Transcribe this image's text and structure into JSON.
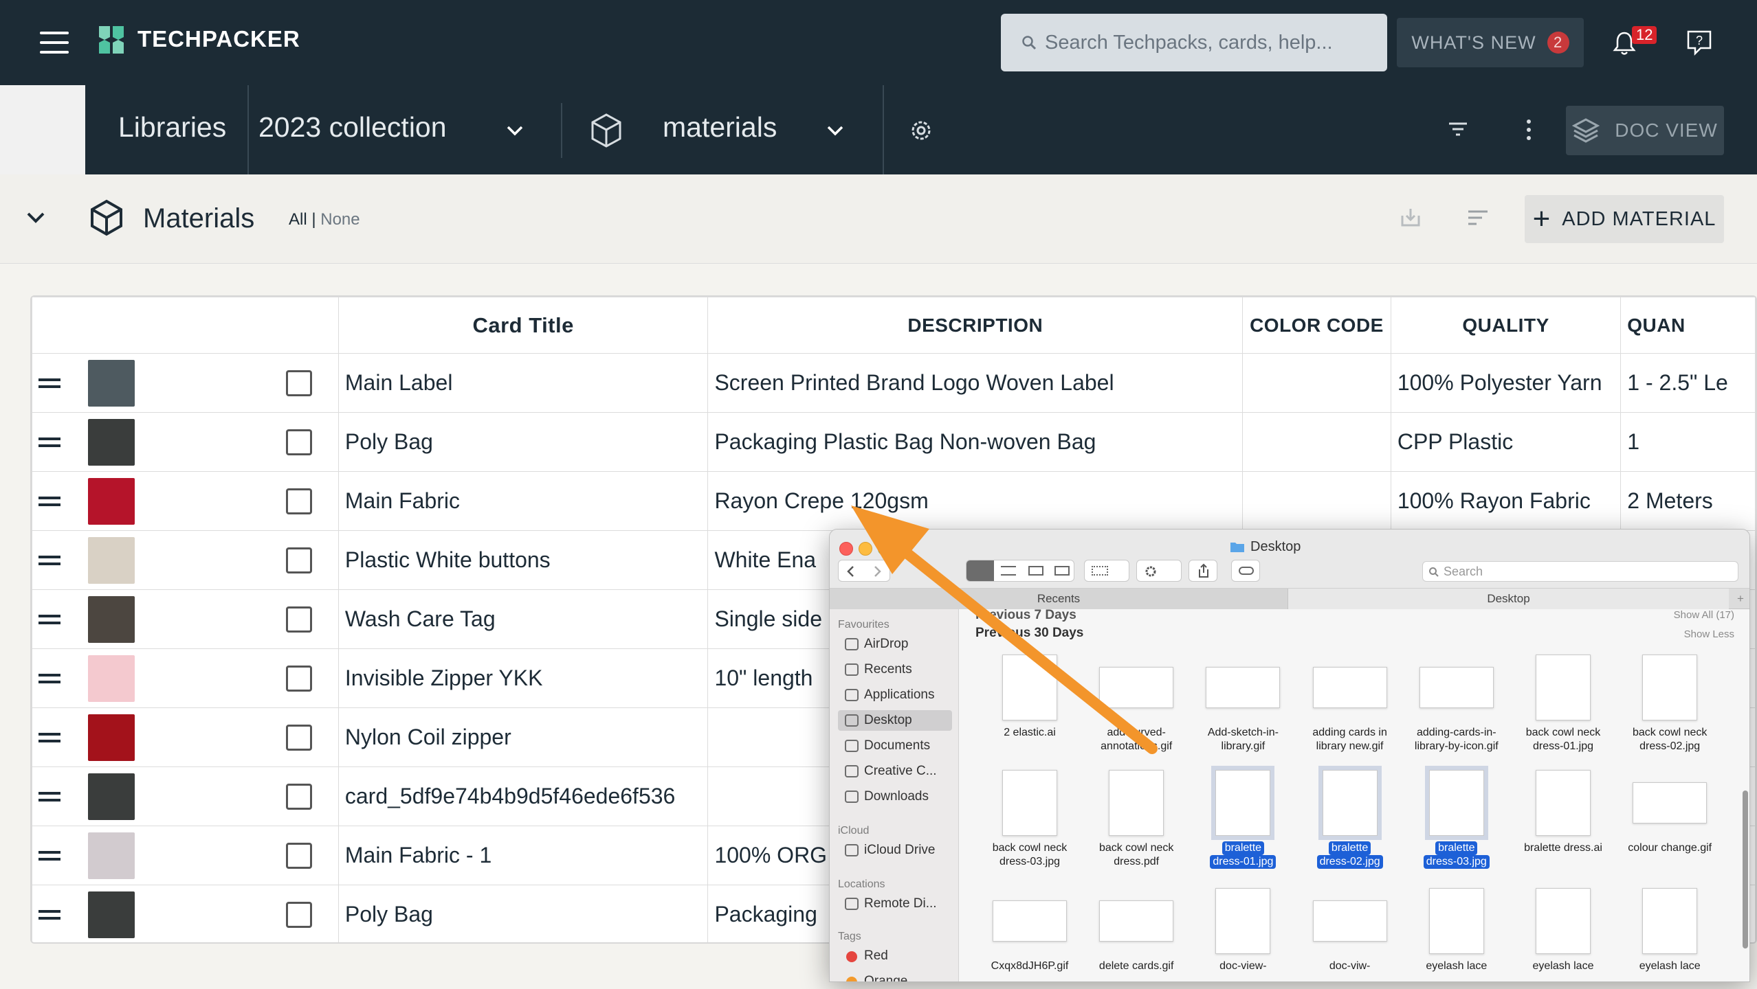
{
  "topbar": {
    "brand": "TECHPACKER",
    "search_placeholder": "Search Techpacks, cards, help...",
    "whats_new": "WHAT'S NEW",
    "whats_new_count": "2",
    "notifications_count": "12"
  },
  "secbar": {
    "libraries": "Libraries",
    "collection": "2023 collection",
    "materials": "materials",
    "doc_view": "DOC VIEW"
  },
  "materials_header": {
    "title": "Materials",
    "all": "All",
    "separator": "|",
    "none": "None",
    "add_button": "ADD MATERIAL"
  },
  "table": {
    "headers": [
      "Card Title",
      "DESCRIPTION",
      "COLOR CODE",
      "QUALITY",
      "QUAN"
    ],
    "rows": [
      {
        "title": "Main Label",
        "description": "Screen Printed Brand Logo Woven Label",
        "color_code": "",
        "quality": "100% Polyester Yarn",
        "quantity": "1 - 2.5\" Le",
        "thumb": "#4e5a60"
      },
      {
        "title": "Poly Bag",
        "description": "Packaging Plastic Bag Non-woven Bag",
        "color_code": "",
        "quality": "CPP Plastic",
        "quantity": "1",
        "thumb": "#3a3d3c"
      },
      {
        "title": "Main Fabric",
        "description": "Rayon Crepe 120gsm",
        "color_code": "",
        "quality": "100% Rayon Fabric",
        "quantity": "2 Meters",
        "thumb": "#b5142a"
      },
      {
        "title": "Plastic White buttons",
        "description": "White Ena",
        "color_code": "",
        "quality": "",
        "quantity": "",
        "thumb": "#d9d1c5"
      },
      {
        "title": "Wash Care Tag",
        "description": "Single side",
        "color_code": "",
        "quality": "",
        "quantity": "",
        "thumb": "#4c4640"
      },
      {
        "title": "Invisible Zipper YKK",
        "description": "10\" length",
        "color_code": "",
        "quality": "",
        "quantity": "",
        "thumb": "#f4c9cf"
      },
      {
        "title": "Nylon Coil zipper",
        "description": "",
        "color_code": "",
        "quality": "",
        "quantity": "",
        "thumb": "#a3121b"
      },
      {
        "title": "card_5df9e74b4b9d5f46ede6f536",
        "description": "",
        "color_code": "",
        "quality": "",
        "quantity": "",
        "thumb": "#3a3d3c"
      },
      {
        "title": "Main Fabric  - 1",
        "description": "100% ORG",
        "color_code": "",
        "quality": "",
        "quantity": "",
        "thumb": "#d2cbcf"
      },
      {
        "title": "Poly Bag",
        "description": "Packaging",
        "color_code": "",
        "quality": "",
        "quantity": "",
        "thumb": "#3a3d3c"
      }
    ]
  },
  "finder": {
    "title": "Desktop",
    "search_placeholder": "Search",
    "tabs": [
      "Recents",
      "Desktop"
    ],
    "sidebar": {
      "favourites_label": "Favourites",
      "favourites": [
        "AirDrop",
        "Recents",
        "Applications",
        "Desktop",
        "Documents",
        "Creative C...",
        "Downloads"
      ],
      "icloud_label": "iCloud",
      "icloud": [
        "iCloud Drive"
      ],
      "locations_label": "Locations",
      "locations": [
        "Remote Di..."
      ],
      "tags_label": "Tags",
      "tags": [
        "Red",
        "Orange"
      ]
    },
    "group1": {
      "label": "Previous 7 Days",
      "show": "Show All (17)"
    },
    "group2": {
      "label": "Previous 30 Days",
      "show": "Show Less"
    },
    "files_row1": [
      [
        "2 elastic.ai",
        ""
      ],
      [
        "add-curved-",
        "annotations.gif"
      ],
      [
        "Add-sketch-in-",
        "library.gif"
      ],
      [
        "adding cards in",
        "library new.gif"
      ],
      [
        "adding-cards-in-",
        "library-by-icon.gif"
      ],
      [
        "back cowl neck",
        "dress-01.jpg"
      ],
      [
        "back cowl neck",
        "dress-02.jpg"
      ]
    ],
    "files_row2": [
      [
        "back cowl neck",
        "dress-03.jpg"
      ],
      [
        "back cowl neck",
        "dress.pdf"
      ],
      [
        "bralette",
        "dress-01.jpg"
      ],
      [
        "bralette",
        "dress-02.jpg"
      ],
      [
        "bralette",
        "dress-03.jpg"
      ],
      [
        "bralette dress.ai",
        ""
      ],
      [
        "colour change.gif",
        ""
      ]
    ],
    "files_row3": [
      "Cxqx8dJH6P.gif",
      "delete cards.gif",
      "doc-view-",
      "doc-viw-",
      "eyelash lace",
      "eyelash lace",
      "eyelash lace"
    ]
  }
}
